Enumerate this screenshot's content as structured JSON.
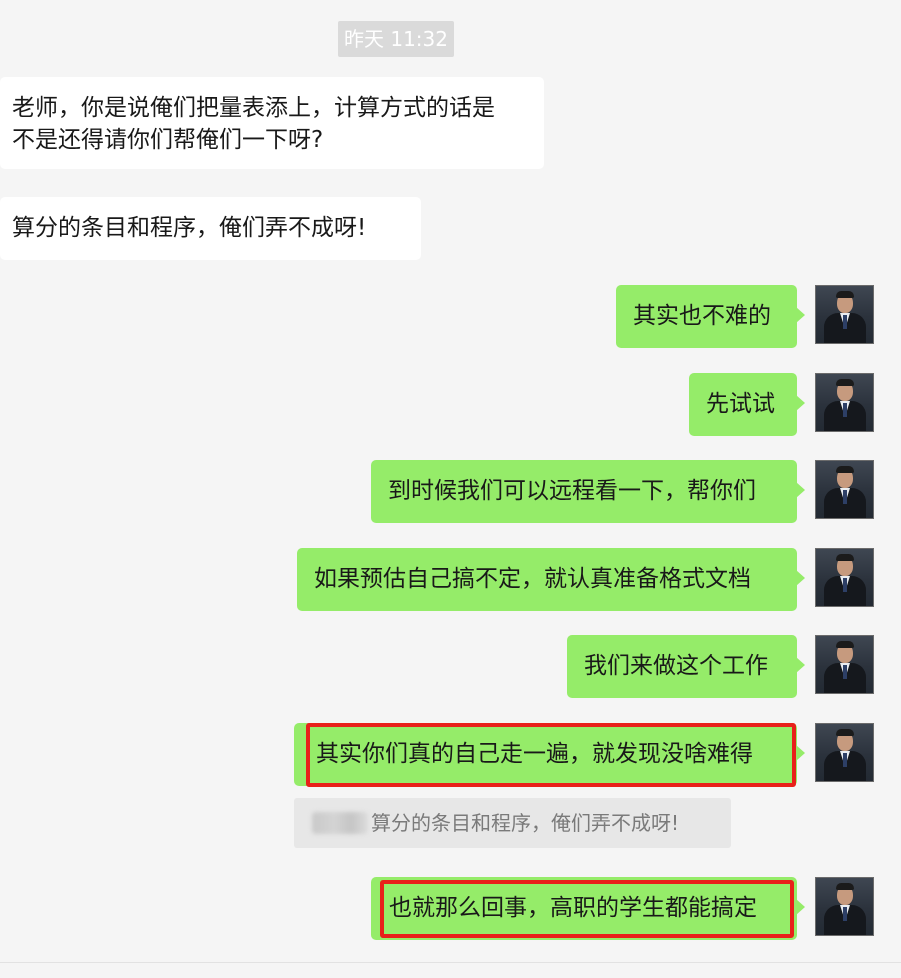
{
  "timestamp": "昨天 11:32",
  "incoming": [
    {
      "lines": [
        "老师，你是说俺们把量表添上，计算方式的话是",
        "不是还得请你们帮俺们一下呀?"
      ]
    },
    {
      "lines": [
        "算分的条目和程序，俺们弄不成呀!"
      ]
    }
  ],
  "outgoing": [
    {
      "text": "其实也不难的"
    },
    {
      "text": "先试试"
    },
    {
      "text": "到时候我们可以远程看一下，帮你们"
    },
    {
      "text": "如果预估自己搞不定，就认真准备格式文档"
    },
    {
      "text": "我们来做这个工作"
    },
    {
      "text": "其实你们真的自己走一遍，就发现没啥难得"
    },
    {
      "text": "也就那么回事，高职的学生都能搞定"
    }
  ],
  "quote": {
    "text": "算分的条目和程序，俺们弄不成呀!"
  },
  "colors": {
    "outgoing_bubble": "#95ec69",
    "incoming_bubble": "#ffffff",
    "highlight_border": "#e8201a",
    "background": "#f5f5f5"
  },
  "icons": {
    "avatar": "user-avatar-photo"
  }
}
